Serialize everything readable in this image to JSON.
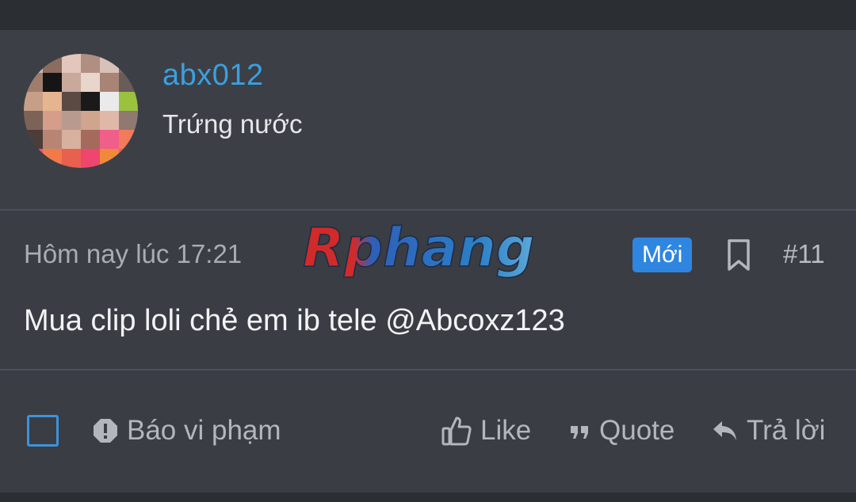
{
  "user": {
    "username": "abx012",
    "title": "Trứng nước",
    "avatar_icon": "avatar-collage"
  },
  "post": {
    "date": "Hôm nay lúc 17:21",
    "badge": "Mới",
    "number": "#11",
    "message": "Mua clip loli chẻ em ib tele @Abcoxz123"
  },
  "watermark": {
    "text": "Rphang"
  },
  "actions": {
    "report_label": "Báo vi phạm",
    "like_label": "Like",
    "quote_label": "Quote",
    "reply_label": "Trả lời"
  },
  "colors": {
    "accent": "#3aa0e0",
    "badge": "#2f86e0",
    "background": "#3a3d44"
  }
}
